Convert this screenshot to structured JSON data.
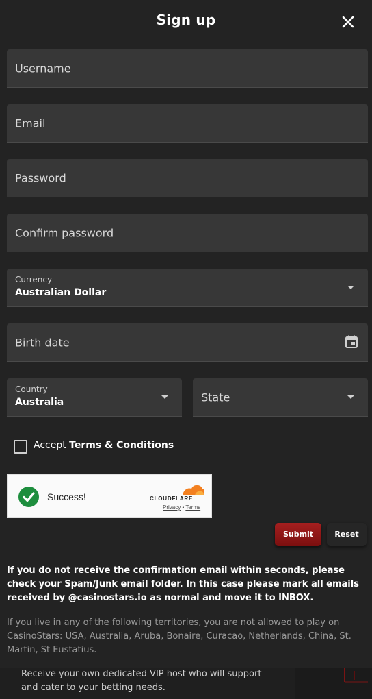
{
  "header": {
    "title": "Sign up",
    "close_icon": "close-icon"
  },
  "form": {
    "username_placeholder": "Username",
    "email_placeholder": "Email",
    "password_placeholder": "Password",
    "confirm_password_placeholder": "Confirm password",
    "currency": {
      "label": "Currency",
      "value": "Australian Dollar"
    },
    "birth_date_placeholder": "Birth date",
    "country": {
      "label": "Country",
      "value": "Australia"
    },
    "state_placeholder": "State",
    "accept_prefix": "Accept",
    "accept_link": "Terms & Conditions",
    "accept_checked": false
  },
  "captcha": {
    "status": "Success!",
    "brand": "CLOUDFLARE",
    "privacy": "Privacy",
    "separator": "•",
    "terms": "Terms"
  },
  "buttons": {
    "submit": "Submit",
    "reset": "Reset"
  },
  "info": {
    "confirmation_note": "If you do not receive the confirmation email within seconds, please check your Spam/Junk email folder. In this case please mark all emails received by @casinostars.io as normal and move it to INBOX.",
    "territories_note": "If you live in any of the following territories, you are not allowed to play on CasinoStars: USA, Australia, Aruba, Bonaire, Curacao, Netherlands, China, St. Martin, St Eustatius."
  },
  "background_promo": {
    "text": "Receive your own dedicated VIP host who will support and cater to your betting needs."
  },
  "colors": {
    "background": "#232323",
    "field": "#373737",
    "submit": "#a51f1f",
    "success_green": "#1e8e3e",
    "cloudflare_orange": "#f38020"
  }
}
